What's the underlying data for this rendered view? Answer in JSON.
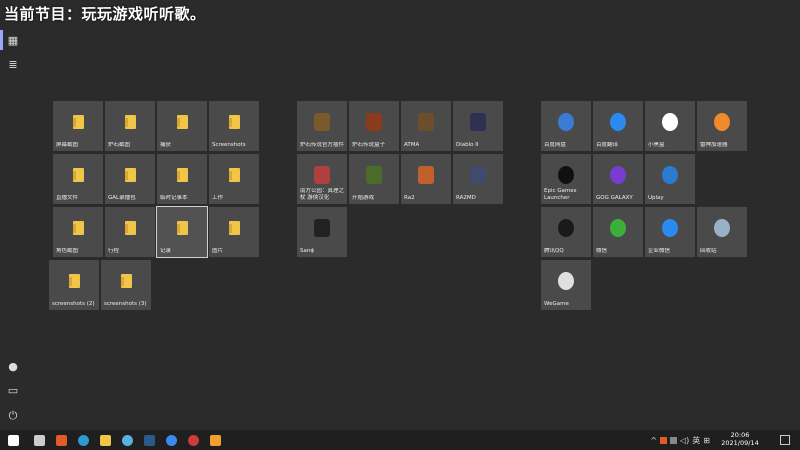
{
  "overlay": {
    "title": "当前节目：玩玩游戏听听歌。"
  },
  "left_rail": {
    "top_items": [
      {
        "name": "pinned-tiles-icon",
        "glyph": "▦"
      },
      {
        "name": "all-apps-list-icon",
        "glyph": "≣"
      }
    ],
    "bottom_items": [
      {
        "name": "user-avatar",
        "glyph": "●"
      },
      {
        "name": "pictures-icon",
        "glyph": "▭"
      },
      {
        "name": "power-icon",
        "glyph": "⏻"
      }
    ]
  },
  "groups": {
    "folders": [
      {
        "label": "屏幕截图"
      },
      {
        "label": "炉石截图"
      },
      {
        "label": "捕获"
      },
      {
        "label": "Screenshots"
      },
      {
        "label": "直播文件"
      },
      {
        "label": "GAL录播包"
      },
      {
        "label": "临时记事本"
      },
      {
        "label": "工作"
      },
      {
        "label": "角色截图"
      },
      {
        "label": "行程"
      },
      {
        "label": "记录"
      },
      {
        "label": "图片"
      },
      {
        "label": "screenshots (2)"
      },
      {
        "label": "screenshots (3)"
      }
    ],
    "games": [
      {
        "label": "炉石传说官方插件",
        "icon": "hs-plugin-icon",
        "color": "#7a5a2a"
      },
      {
        "label": "炉石传说盒子",
        "icon": "hs-box-icon",
        "color": "#8a3b1d"
      },
      {
        "label": "ATMA",
        "icon": "atma-icon",
        "color": "#6b4f2a"
      },
      {
        "label": "Diablo II",
        "icon": "diablo2-icon",
        "color": "#303055"
      },
      {
        "label": "南方公园：真理之杖 游侠汉化",
        "icon": "south-park-icon",
        "color": "#b04040"
      },
      {
        "label": "开始游戏",
        "icon": "start-game-icon",
        "color": "#4a6b2a"
      },
      {
        "label": "Ra2",
        "icon": "ra2-icon",
        "color": "#c0602a"
      },
      {
        "label": "RA2MD",
        "icon": "ra2md-icon",
        "color": "#404a6a"
      },
      {
        "label": "Sanɸ",
        "icon": "sanc-icon",
        "color": "#222222"
      }
    ],
    "apps": [
      {
        "label": "百度网盘",
        "icon": "baidu-netdisk-icon",
        "color": "#3a7bd5"
      },
      {
        "label": "百度翻译",
        "icon": "baidu-translate-icon",
        "color": "#2a8af0"
      },
      {
        "label": "小黑盒",
        "icon": "heybox-icon",
        "color": "#ffffff"
      },
      {
        "label": "雷神加速器",
        "icon": "leishen-icon",
        "color": "#f08a2a"
      },
      {
        "label": "Epic Games Launcher",
        "icon": "epic-games-icon",
        "color": "#111111"
      },
      {
        "label": "GOG GALAXY",
        "icon": "gog-galaxy-icon",
        "color": "#7a3bd0"
      },
      {
        "label": "Uplay",
        "icon": "uplay-icon",
        "color": "#2a7ad0"
      },
      {
        "label": "腾讯QQ",
        "icon": "qq-icon",
        "color": "#1a1a1a"
      },
      {
        "label": "微信",
        "icon": "wechat-icon",
        "color": "#3ab03a"
      },
      {
        "label": "企业微信",
        "icon": "wecom-icon",
        "color": "#2a8af0"
      },
      {
        "label": "回收站",
        "icon": "recycle-bin-icon",
        "color": "#9ab0c8"
      },
      {
        "label": "WeGame",
        "icon": "wegame-icon",
        "color": "#e0e0e0"
      }
    ]
  },
  "taskbar": {
    "apps": [
      {
        "name": "start-icon",
        "color": "#ffffff"
      },
      {
        "name": "task-view-icon",
        "color": "#cccccc"
      },
      {
        "name": "taskbar-app-orange-icon",
        "color": "#e05a2a"
      },
      {
        "name": "edge-icon",
        "color": "#2a9ad0"
      },
      {
        "name": "file-explorer-icon",
        "color": "#f0c54a"
      },
      {
        "name": "taskbar-app-clock-icon",
        "color": "#5ab0e0"
      },
      {
        "name": "steam-icon",
        "color": "#2a5a8a"
      },
      {
        "name": "taskbar-app-blue-icon",
        "color": "#3a8af0"
      },
      {
        "name": "netease-music-icon",
        "color": "#d03a3a"
      },
      {
        "name": "taskbar-app-yellow-icon",
        "color": "#f0a030"
      }
    ],
    "tray": {
      "chevron": "^",
      "volume": "◁)",
      "ime": "英",
      "grid": "⊞"
    },
    "clock": {
      "time": "20:06",
      "date": "2021/09/14"
    }
  }
}
